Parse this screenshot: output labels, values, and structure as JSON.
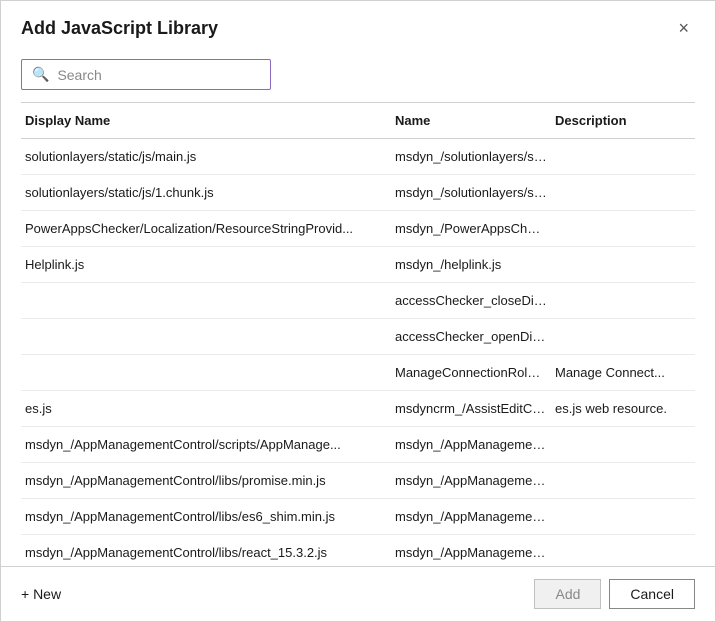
{
  "dialog": {
    "title": "Add JavaScript Library",
    "close_label": "×"
  },
  "search": {
    "placeholder": "Search",
    "value": ""
  },
  "table": {
    "headers": [
      "Display Name",
      "Name",
      "Description"
    ],
    "rows": [
      {
        "display_name": "solutionlayers/static/js/main.js",
        "name": "msdyn_/solutionlayers/sta...",
        "description": ""
      },
      {
        "display_name": "solutionlayers/static/js/1.chunk.js",
        "name": "msdyn_/solutionlayers/sta...",
        "description": ""
      },
      {
        "display_name": "PowerAppsChecker/Localization/ResourceStringProvid...",
        "name": "msdyn_/PowerAppsCheck...",
        "description": ""
      },
      {
        "display_name": "Helplink.js",
        "name": "msdyn_/helplink.js",
        "description": ""
      },
      {
        "display_name": "",
        "name": "accessChecker_closeDialo...",
        "description": ""
      },
      {
        "display_name": "",
        "name": "accessChecker_openDialo...",
        "description": ""
      },
      {
        "display_name": "",
        "name": "ManageConnectionRoles...",
        "description": "Manage Connect..."
      },
      {
        "display_name": "es.js",
        "name": "msdyncrm_/AssistEditCon...",
        "description": "es.js web resource."
      },
      {
        "display_name": "msdyn_/AppManagementControl/scripts/AppManage...",
        "name": "msdyn_/AppManagement...",
        "description": ""
      },
      {
        "display_name": "msdyn_/AppManagementControl/libs/promise.min.js",
        "name": "msdyn_/AppManagement...",
        "description": ""
      },
      {
        "display_name": "msdyn_/AppManagementControl/libs/es6_shim.min.js",
        "name": "msdyn_/AppManagement...",
        "description": ""
      },
      {
        "display_name": "msdyn_/AppManagementControl/libs/react_15.3.2.js",
        "name": "msdyn_/AppManagement...",
        "description": ""
      }
    ]
  },
  "footer": {
    "new_label": "+ New",
    "add_label": "Add",
    "cancel_label": "Cancel"
  }
}
